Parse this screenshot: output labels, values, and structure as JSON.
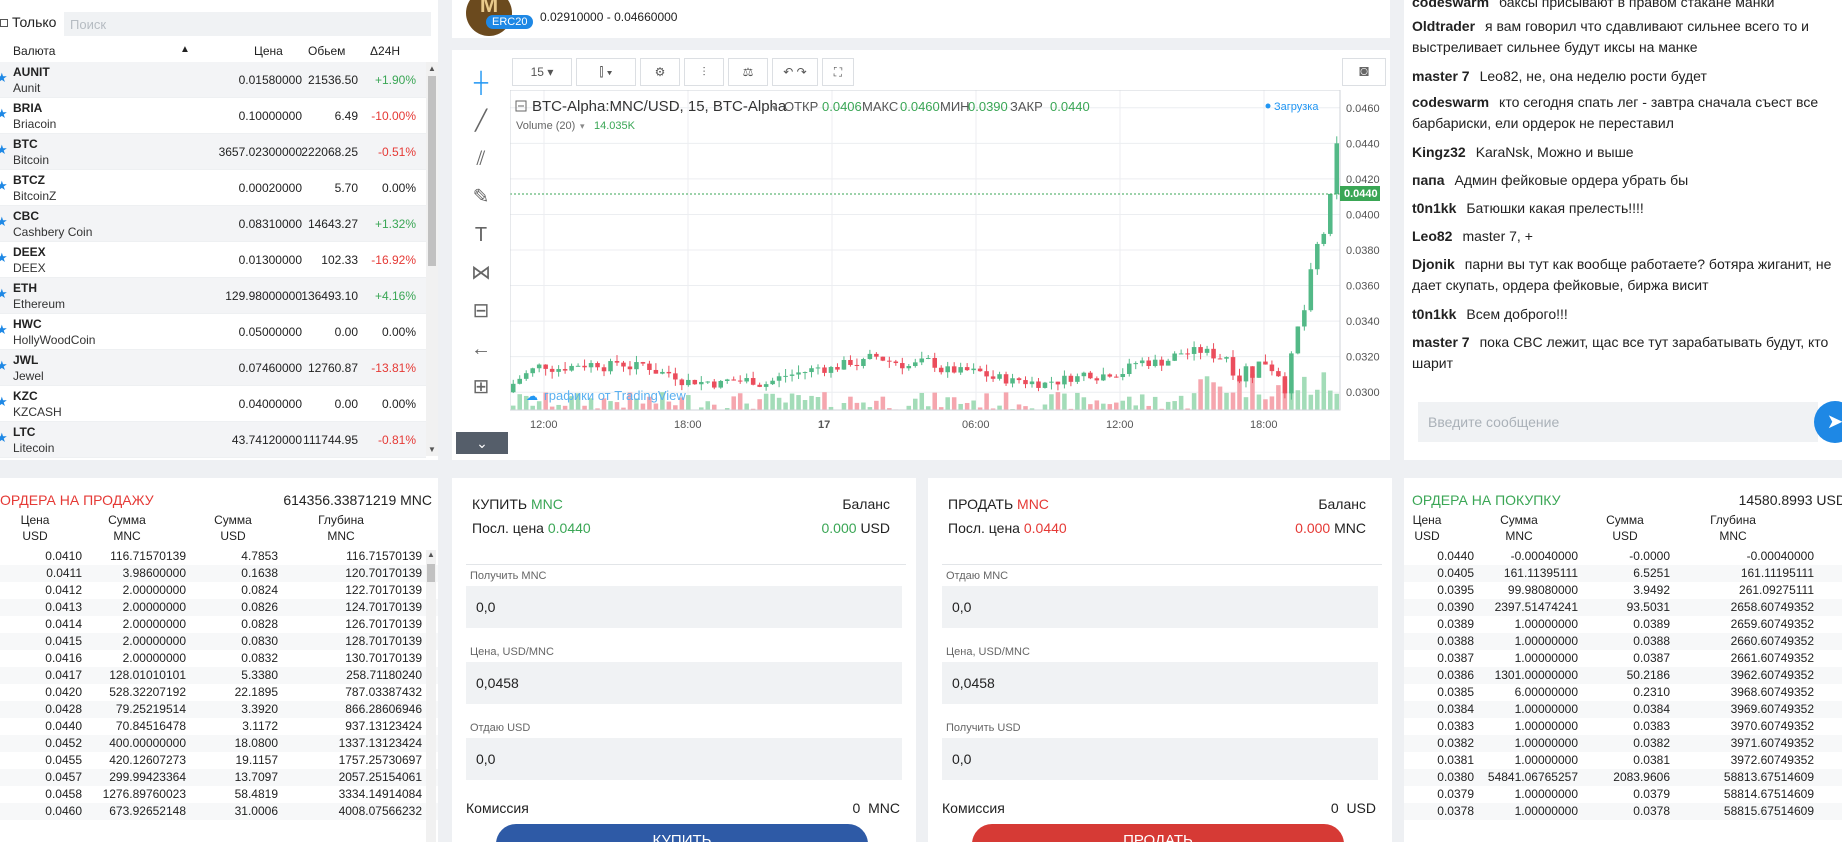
{
  "markets": {
    "only_label": "Только",
    "search_placeholder": "Поиск",
    "headers": {
      "currency": "Валюта",
      "price": "Цена",
      "volume": "Обьем",
      "change": "Δ24H"
    },
    "rows": [
      {
        "code": "AUNIT",
        "name": "Aunit",
        "price": "0.01580000",
        "volume": "21536.50",
        "change": "+1.90%",
        "dir": "up"
      },
      {
        "code": "BRIA",
        "name": "Briacoin",
        "price": "0.10000000",
        "volume": "6.49",
        "change": "-10.00%",
        "dir": "down"
      },
      {
        "code": "BTC",
        "name": "Bitcoin",
        "price": "3657.02300000",
        "volume": "222068.25",
        "change": "-0.51%",
        "dir": "down"
      },
      {
        "code": "BTCZ",
        "name": "BitcoinZ",
        "price": "0.00020000",
        "volume": "5.70",
        "change": "0.00%",
        "dir": "flat"
      },
      {
        "code": "CBC",
        "name": "Cashbery Coin",
        "price": "0.08310000",
        "volume": "14643.27",
        "change": "+1.32%",
        "dir": "up"
      },
      {
        "code": "DEEX",
        "name": "DEEX",
        "price": "0.01300000",
        "volume": "102.33",
        "change": "-16.92%",
        "dir": "down"
      },
      {
        "code": "ETH",
        "name": "Ethereum",
        "price": "129.98000000",
        "volume": "136493.10",
        "change": "+4.16%",
        "dir": "up"
      },
      {
        "code": "HWC",
        "name": "HollyWoodCoin",
        "price": "0.05000000",
        "volume": "0.00",
        "change": "0.00%",
        "dir": "flat"
      },
      {
        "code": "JWL",
        "name": "Jewel",
        "price": "0.07460000",
        "volume": "12760.87",
        "change": "-13.81%",
        "dir": "down"
      },
      {
        "code": "KZC",
        "name": "KZCASH",
        "price": "0.04000000",
        "volume": "0.00",
        "change": "0.00%",
        "dir": "flat"
      },
      {
        "code": "LTC",
        "name": "Litecoin",
        "price": "43.74120000",
        "volume": "111744.95",
        "change": "-0.81%",
        "dir": "down"
      }
    ]
  },
  "topinfo": {
    "logo_letter": "M",
    "badge": "ERC20",
    "range": "0.02910000 - 0.04660000"
  },
  "chart": {
    "interval": "15",
    "title": "BTC-Alpha:MNC/USD, 15, BTC-Alpha",
    "open_label": "ОТКР",
    "open": "0.0406",
    "high_label": "МАКС",
    "high": "0.0460",
    "low_label": "МИН",
    "low": "0.0390",
    "close_label": "ЗАКР",
    "close": "0.0440",
    "loading": "Загрузка",
    "volume_label": "Volume (20)",
    "volume_value": "14.035K",
    "watermark": "графики от TradingView",
    "last_price_tag": "0.0440"
  },
  "chart_data": {
    "type": "candlestick",
    "title": "BTC-Alpha:MNC/USD, 15, BTC-Alpha",
    "x_ticks": [
      "12:00",
      "18:00",
      "17",
      "06:00",
      "12:00",
      "18:00"
    ],
    "y_ticks": [
      "0.0460",
      "0.0440",
      "0.0420",
      "0.0400",
      "0.0380",
      "0.0360",
      "0.0340",
      "0.0320",
      "0.0300"
    ],
    "ylim": [
      0.029,
      0.047
    ],
    "last_price": 0.044,
    "ohlc": {
      "open": 0.0406,
      "high": 0.046,
      "low": 0.039,
      "close": 0.044
    },
    "volume": {
      "label": "Volume (20)",
      "value": "14.035K"
    }
  },
  "chat": {
    "messages": [
      {
        "user": "codeswarm",
        "text": "баксы присывают в правом стакане манки"
      },
      {
        "user": "Oldtrader",
        "text": "я вам говорил что сдавливают сильнее всего то и выстреливает сильнее будут иксы на манке"
      },
      {
        "user": "master 7",
        "text": "Leo82, не, она неделю рости будет"
      },
      {
        "user": "codeswarm",
        "text": "кто сегодня спать лег - завтра сначала съест все барбариски, ели ордерок не переставил"
      },
      {
        "user": "Kingz32",
        "text": "KaraNsk, Можно и выше"
      },
      {
        "user": "папа",
        "text": "Админ фейковые ордера убрать бы"
      },
      {
        "user": "t0n1kk",
        "text": "Батюшки какая прелесть!!!!"
      },
      {
        "user": "Leo82",
        "text": "master 7, +"
      },
      {
        "user": "Djonik",
        "text": "парни вы тут как вообще работаете? ботяра жиганит, не дает скупать, ордера фейковые, биржа висит"
      },
      {
        "user": "t0n1kk",
        "text": "Всем доброго!!!"
      },
      {
        "user": "master 7",
        "text": "пока CBC лежит, щас все тут зарабатывать будут, кто шарит"
      }
    ],
    "input_placeholder": "Введите сообщение"
  },
  "sellbook": {
    "title": "ордера на продажу",
    "total": "614356.33871219 MNC",
    "headers": [
      [
        "Цена",
        "USD"
      ],
      [
        "Сумма",
        "MNC"
      ],
      [
        "Сумма",
        "USD"
      ],
      [
        "Глубина",
        "MNC"
      ]
    ],
    "rows": [
      [
        "0.0410",
        "116.71570139",
        "4.7853",
        "116.71570139"
      ],
      [
        "0.0411",
        "3.98600000",
        "0.1638",
        "120.70170139"
      ],
      [
        "0.0412",
        "2.00000000",
        "0.0824",
        "122.70170139"
      ],
      [
        "0.0413",
        "2.00000000",
        "0.0826",
        "124.70170139"
      ],
      [
        "0.0414",
        "2.00000000",
        "0.0828",
        "126.70170139"
      ],
      [
        "0.0415",
        "2.00000000",
        "0.0830",
        "128.70170139"
      ],
      [
        "0.0416",
        "2.00000000",
        "0.0832",
        "130.70170139"
      ],
      [
        "0.0417",
        "128.01010101",
        "5.3380",
        "258.71180240"
      ],
      [
        "0.0420",
        "528.32207192",
        "22.1895",
        "787.03387432"
      ],
      [
        "0.0428",
        "79.25219514",
        "3.3920",
        "866.28606946"
      ],
      [
        "0.0440",
        "70.84516478",
        "3.1172",
        "937.13123424"
      ],
      [
        "0.0452",
        "400.00000000",
        "18.0800",
        "1337.13123424"
      ],
      [
        "0.0455",
        "420.12607273",
        "19.1157",
        "1757.25730697"
      ],
      [
        "0.0457",
        "299.99423364",
        "13.7097",
        "2057.25154061"
      ],
      [
        "0.0458",
        "1276.89760023",
        "58.4819",
        "3334.14914084"
      ],
      [
        "0.0460",
        "673.92652148",
        "31.0006",
        "4008.07566232"
      ]
    ]
  },
  "buybook": {
    "title": "ордера на покупку",
    "total": "14580.8993 USD",
    "headers": [
      [
        "Цена",
        "USD"
      ],
      [
        "Сумма",
        "MNC"
      ],
      [
        "Сумма",
        "USD"
      ],
      [
        "Глубина",
        "MNC"
      ]
    ],
    "rows": [
      [
        "0.0440",
        "-0.00040000",
        "-0.0000",
        "-0.00040000"
      ],
      [
        "0.0405",
        "161.11395111",
        "6.5251",
        "161.11195111"
      ],
      [
        "0.0395",
        "99.98080000",
        "3.9492",
        "261.09275111"
      ],
      [
        "0.0390",
        "2397.51474241",
        "93.5031",
        "2658.60749352"
      ],
      [
        "0.0389",
        "1.00000000",
        "0.0389",
        "2659.60749352"
      ],
      [
        "0.0388",
        "1.00000000",
        "0.0388",
        "2660.60749352"
      ],
      [
        "0.0387",
        "1.00000000",
        "0.0387",
        "2661.60749352"
      ],
      [
        "0.0386",
        "1301.00000000",
        "50.2186",
        "3962.60749352"
      ],
      [
        "0.0385",
        "6.00000000",
        "0.2310",
        "3968.60749352"
      ],
      [
        "0.0384",
        "1.00000000",
        "0.0384",
        "3969.60749352"
      ],
      [
        "0.0383",
        "1.00000000",
        "0.0383",
        "3970.60749352"
      ],
      [
        "0.0382",
        "1.00000000",
        "0.0382",
        "3971.60749352"
      ],
      [
        "0.0381",
        "1.00000000",
        "0.0381",
        "3972.60749352"
      ],
      [
        "0.0380",
        "54841.06765257",
        "2083.9606",
        "58813.67514609"
      ],
      [
        "0.0379",
        "1.00000000",
        "0.0379",
        "58814.67514609"
      ],
      [
        "0.0378",
        "1.00000000",
        "0.0378",
        "58815.67514609"
      ]
    ]
  },
  "buyform": {
    "title": "КУПИТЬ",
    "coin": "MNC",
    "balance_label": "Баланс",
    "last_label": "Посл. цена",
    "last_price": "0.0440",
    "balance_value": "0.000",
    "balance_unit": "USD",
    "f1_label": "Получить MNC",
    "f1_value": "0,0",
    "f2_label": "Цена, USD/MNC",
    "f2_value": "0,0458",
    "f3_label": "Отдаю USD",
    "f3_value": "0,0",
    "fee_label": "Комиссия",
    "fee_value": "0",
    "fee_unit": "MNC",
    "button": "КУПИТЬ"
  },
  "sellform": {
    "title": "ПРОДАТЬ",
    "coin": "MNC",
    "balance_label": "Баланс",
    "last_label": "Посл. цена",
    "last_price": "0.0440",
    "balance_value": "0.000",
    "balance_unit": "MNC",
    "f1_label": "Отдаю MNC",
    "f1_value": "0,0",
    "f2_label": "Цена, USD/MNC",
    "f2_value": "0,0458",
    "f3_label": "Получить USD",
    "f3_value": "0,0",
    "fee_label": "Комиссия",
    "fee_value": "0",
    "fee_unit": "USD",
    "button": "ПРОДАТЬ"
  }
}
